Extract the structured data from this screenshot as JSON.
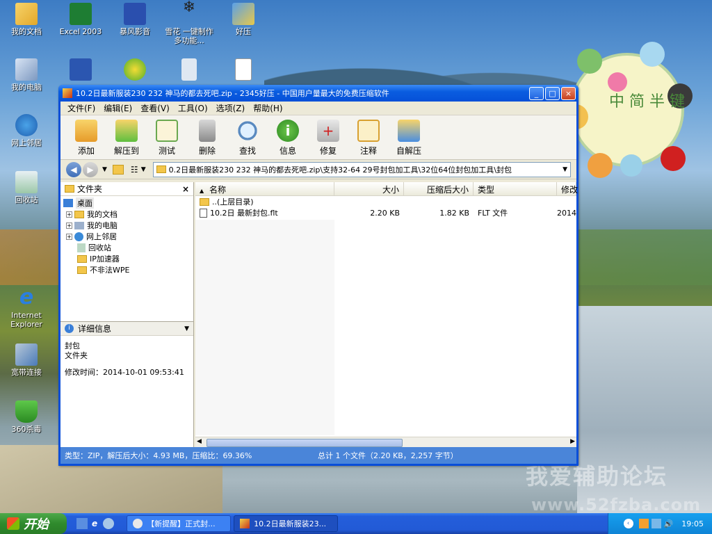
{
  "desktop": {
    "icons": [
      {
        "label": "我的文档",
        "icon": "my-documents-icon"
      },
      {
        "label": "Excel 2003",
        "icon": "excel-icon"
      },
      {
        "label": "暴风影音",
        "icon": "video-player-icon"
      },
      {
        "label": "雪花 一键制作多功能...",
        "icon": "snowflake-tool-icon"
      },
      {
        "label": "好压",
        "icon": "haozip-icon"
      },
      {
        "label": "我的电脑",
        "icon": "my-computer-icon"
      },
      {
        "label": "网上邻居",
        "icon": "network-places-icon"
      },
      {
        "label": "回收站",
        "icon": "recycle-bin-icon"
      },
      {
        "label": "Internet Explorer",
        "icon": "ie-icon"
      },
      {
        "label": "宽带连接",
        "icon": "broadband-icon"
      },
      {
        "label": "360杀毒",
        "icon": "antivirus-icon"
      }
    ],
    "watermark": "我爱辅助论坛",
    "watermark_url": "www.52fzba.com",
    "sticker_text": "中 简 半 键"
  },
  "window": {
    "title": "10.2日最新服装230  232 神马的都去死吧.zip - 2345好压 - 中国用户量最大的免费压缩软件",
    "menu": [
      "文件(F)",
      "编辑(E)",
      "查看(V)",
      "工具(O)",
      "选项(Z)",
      "帮助(H)"
    ],
    "toolbar": [
      {
        "label": "添加",
        "icon": "add-icon"
      },
      {
        "label": "解压到",
        "icon": "extract-to-icon"
      },
      {
        "label": "测试",
        "icon": "test-icon"
      },
      {
        "label": "删除",
        "icon": "delete-icon"
      },
      {
        "label": "查找",
        "icon": "find-icon"
      },
      {
        "label": "信息",
        "icon": "info-icon"
      },
      {
        "label": "修复",
        "icon": "repair-icon"
      },
      {
        "label": "注释",
        "icon": "comment-icon"
      },
      {
        "label": "自解压",
        "icon": "sfx-icon"
      }
    ],
    "address": "0.2日最新服装230  232 神马的都去死吧.zip\\支持32-64 29号封包加工具\\32位64位封包加工具\\封包",
    "folder_pane": {
      "title": "文件夹",
      "tree": [
        {
          "label": "桌面",
          "level": 0
        },
        {
          "label": "我的文档",
          "level": 1
        },
        {
          "label": "我的电脑",
          "level": 1
        },
        {
          "label": "网上邻居",
          "level": 1
        },
        {
          "label": "回收站",
          "level": 1
        },
        {
          "label": "IP加速器",
          "level": 1
        },
        {
          "label": "不非法WPE",
          "level": 1
        }
      ]
    },
    "detail_pane": {
      "title": "详细信息",
      "name": "封包",
      "type": "文件夹",
      "modified": "修改时间：2014-10-01 09:53:41"
    },
    "columns": [
      "名称",
      "大小",
      "压缩后大小",
      "类型",
      "修改"
    ],
    "rows": [
      {
        "name": "..(上层目录)",
        "size": "",
        "packed": "",
        "type": "",
        "modified": ""
      },
      {
        "name": "10.2日  最新封包.flt",
        "size": "2.20 KB",
        "packed": "1.82 KB",
        "type": "FLT 文件",
        "modified": "2014"
      }
    ],
    "status_left": "类型：ZIP，解压后大小：4.93 MB，压缩比：69.36%",
    "status_right": "总计 1 个文件（2.20 KB，2,257 字节）"
  },
  "taskbar": {
    "start_label": "开始",
    "tasks": [
      {
        "label": "【新提醒】正式封...",
        "active": false
      },
      {
        "label": "10.2日最新服装23...",
        "active": true
      }
    ],
    "clock": "19:05"
  }
}
